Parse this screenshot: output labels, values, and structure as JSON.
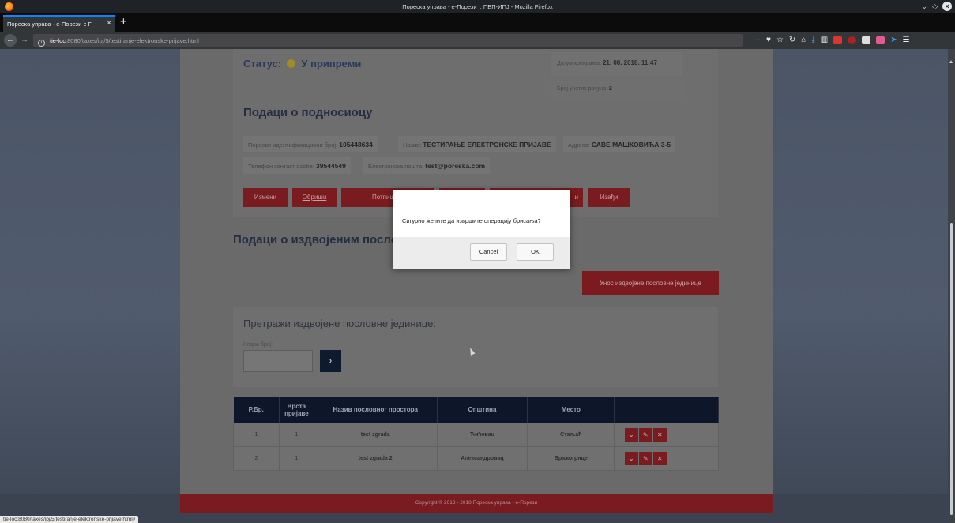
{
  "window": {
    "title": "Пореска управа - е-Порези :: ПЕП-ИПЈ - Mozilla Firefox"
  },
  "tab": {
    "label": "Пореска управа - е-Порези :: Г"
  },
  "address_bar": {
    "host": "tie-loc",
    "path": ":8080/taxes/ipj/5/testiranje-elektronske-prijave.html"
  },
  "page": {
    "status_label": "Статус:",
    "status_value": "У припреми",
    "created_label": "Датум креирања:",
    "created_value": "21. 08. 2018. 11:47",
    "invoices_label": "Број унетих рачуна:",
    "invoices_value": "2",
    "applicant_title": "Подаци о подносиоцу",
    "pib_label": "Порески идентификациони број:",
    "pib_value": "105448634",
    "name_label": "Назив:",
    "name_value": "ТЕСТИРАЊЕ ЕЛЕКТРОНСКЕ ПРИЈАВЕ",
    "address_label": "Адреса:",
    "address_value": "САВЕ МАШКОВИЋА 3-5",
    "phone_label": "Телефон контакт особе:",
    "phone_value": "39544549",
    "email_label": "Електронска пошта:",
    "email_value": "test@poreska.com",
    "buttons": {
      "edit": "Измени",
      "delete": "Обриши",
      "sign": "Потпиши и",
      "fourth": "",
      "fifth": "и",
      "exit": "Изађи"
    },
    "units_title": "Подаци о издвојеним посло",
    "units_add_button": "Унос издвојене пословне јединице",
    "search_title": "Претражи издвојене пословне јединице:",
    "search_label": "Редни број:",
    "search_value": "",
    "search_go": "›",
    "table": {
      "headers": [
        "Р.Бр.",
        "Врста пријаве",
        "Назив пословног простора",
        "Општина",
        "Место",
        ""
      ],
      "rows": [
        {
          "no": "1",
          "type": "1",
          "name": "test zgrada",
          "municipality": "Ћићевац",
          "place": "Стаљаћ"
        },
        {
          "no": "2",
          "type": "1",
          "name": "test zgrada 2",
          "municipality": "Александровац",
          "place": "Вражогрнце"
        }
      ]
    },
    "footer": "Copyright © 2013 - 2018 Пореска управа - е-Порези"
  },
  "dialog": {
    "message": "Сигурно желите да извршите операцију брисања?",
    "cancel": "Cancel",
    "ok": "OK"
  },
  "status_bar_url": "tie-loc:8080/taxes/ipj/5/testiranje-elektronske-prijave.html#"
}
